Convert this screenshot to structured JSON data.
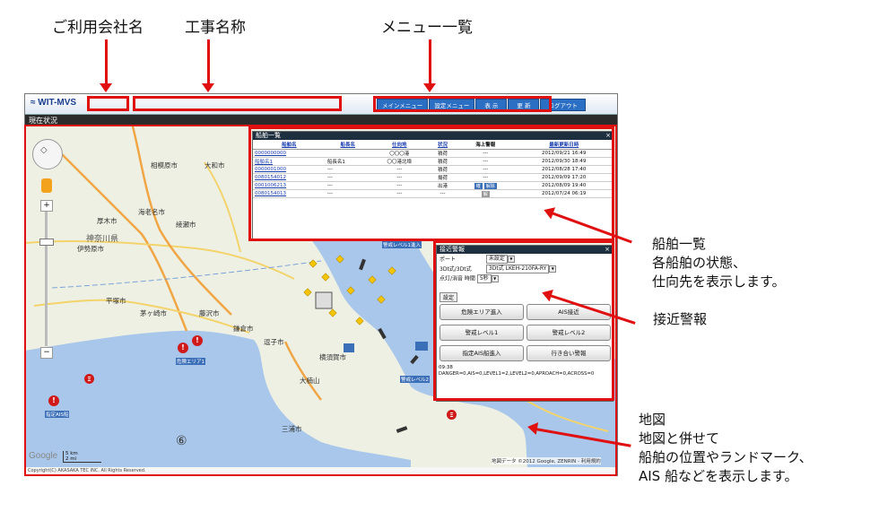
{
  "annotations": {
    "company": "ご利用会社名",
    "project": "工事名称",
    "menu_list": "メニュー一覧",
    "ship_list_title": "船舶一覧",
    "ship_list_desc1": "各船舶の状態、",
    "ship_list_desc2": "仕向先を表示します。",
    "approach_alert": "接近警報",
    "map_title": "地図",
    "map_desc1": "地図と併せて",
    "map_desc2": "船舶の位置やランドマーク、",
    "map_desc3": "AIS 船などを表示します。"
  },
  "app": {
    "logo": "WIT-MVS",
    "status": "現在状況",
    "menu": [
      "メインメニュー",
      "設定メニュー",
      "表 示",
      "更 新",
      "ログアウト"
    ]
  },
  "ship_list": {
    "title": "船舶一覧",
    "close": "×",
    "columns": [
      "船舶名",
      "船長名",
      "仕向地",
      "状況",
      "海上警報",
      "最新更新日時"
    ],
    "rows": [
      [
        "0000000000",
        "",
        "〇〇〇港",
        "積荷",
        "---",
        "2012/09/21 16:49"
      ],
      [
        "船舶名1",
        "船長名1",
        "〇〇港北埠",
        "積荷",
        "---",
        "2012/09/30 18:49"
      ],
      [
        "0000001000",
        "---",
        "---",
        "積荷",
        "---",
        "2012/08/28 17:40"
      ],
      [
        "0080154012",
        "---",
        "---",
        "揚荷",
        "---",
        "2012/09/09 17:20"
      ],
      [
        "0001006213",
        "---",
        "---",
        "出港",
        "BTN",
        "2012/08/09 19:40"
      ],
      [
        "0080154013",
        "---",
        "---",
        "---",
        "GRAY",
        "2012/07/24 06:19"
      ]
    ],
    "row5_btn1": "確",
    "row5_btn2": "解除",
    "row6_btn": "解"
  },
  "alert_panel": {
    "title": "接近警報",
    "close": "×",
    "port_label": "ポート",
    "port_value": "未設定",
    "model_label": "3Dt式/3Dt式",
    "model_value": "3Dt式 LKEH-210FA-RY",
    "time_label": "点灯/消音 時間",
    "time_value": "5秒",
    "set_button": "設定",
    "buttons": [
      "危険エリア進入",
      "AIS接近",
      "警戒レベル1",
      "警戒レベル2",
      "指定AIS船進入",
      "行き合い警報"
    ],
    "log_time": "09:38",
    "log_text": "DANGER=0,AIS=0,LEVEL1=2,LEVEL2=0,APROACH=0,ACROSS=0"
  },
  "map": {
    "cities": [
      "相模原市",
      "大和市",
      "厚木市",
      "海老名市",
      "綾瀬市",
      "伊勢原市",
      "神奈川県",
      "平塚市",
      "茅ヶ崎市",
      "藤沢市",
      "逗子市",
      "横須賀市",
      "大楠山",
      "鎌倉市",
      "三浦市"
    ],
    "markers": [
      {
        "label": "危険エリア1"
      },
      {
        "label": "指定AIS船"
      },
      {
        "label": "警戒レベル1進入"
      },
      {
        "label": "警戒レベル2"
      }
    ],
    "scale_km": "5 km",
    "scale_mi": "2 mi",
    "google": "Google",
    "attribution": "地図データ ©2012 Google, ZENRIN - 利用規約",
    "copyright": "Copyright(C) AKASAKA TEC INC. All Rights Reserved.",
    "number_marker": "⑥"
  },
  "colors": {
    "accent_red": "#e01010",
    "menu_blue": "#2b6fc4"
  }
}
